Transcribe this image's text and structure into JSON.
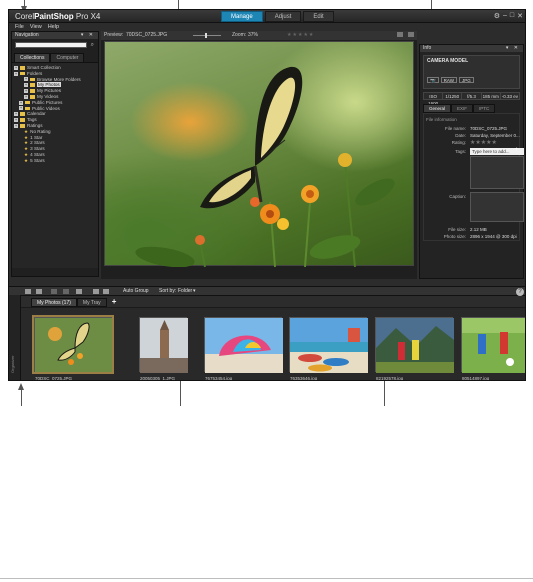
{
  "app": {
    "title_pre": "Corel",
    "title_strong": "PaintShop",
    "title_post": "Pro X4",
    "mode_tabs": [
      "Manage",
      "Adjust",
      "Edit"
    ],
    "active_mode": "Manage",
    "window_controls": [
      "⚙",
      "–",
      "□",
      "✕"
    ]
  },
  "menu": {
    "items": [
      "File",
      "View",
      "Help"
    ]
  },
  "navigation": {
    "header": "Navigation",
    "tabs": [
      "Collections",
      "Computer"
    ],
    "tree": [
      {
        "label": "Smart Collection",
        "icon": "folder"
      },
      {
        "label": "Folders",
        "icon": "folder"
      },
      {
        "label": "Browse More Folders",
        "icon": "folder",
        "indent": 2
      },
      {
        "label": "My Photos",
        "icon": "folder",
        "indent": 2,
        "selected": true
      },
      {
        "label": "My Pictures",
        "icon": "folder",
        "indent": 2
      },
      {
        "label": "My Videos",
        "icon": "folder",
        "indent": 2
      },
      {
        "label": "Public Pictures",
        "icon": "folder",
        "indent": 1
      },
      {
        "label": "Public Videos",
        "icon": "folder",
        "indent": 1
      },
      {
        "label": "Calendar",
        "icon": "folder"
      },
      {
        "label": "Tags",
        "icon": "folder"
      },
      {
        "label": "Ratings",
        "icon": "folder"
      },
      {
        "label": "No Rating",
        "icon": "star",
        "indent": 2
      },
      {
        "label": "1 Star",
        "icon": "star",
        "indent": 2
      },
      {
        "label": "2 Stars",
        "icon": "star",
        "indent": 2
      },
      {
        "label": "3 Stars",
        "icon": "star",
        "indent": 2
      },
      {
        "label": "4 Stars",
        "icon": "star",
        "indent": 2
      },
      {
        "label": "5 Stars",
        "icon": "star",
        "indent": 2
      }
    ]
  },
  "preview": {
    "label": "Preview:",
    "filename": "70DSC_0725.JPG",
    "zoom_label": "Zoom:",
    "zoom_value": "37%",
    "stars": "★★★★★"
  },
  "info": {
    "header": "Info",
    "camera_model": "CAMERA MODEL",
    "file_badges": [
      "RAW",
      "JPG"
    ],
    "exif": [
      "ISO 1600",
      "1/1250",
      "f/5.3",
      "185 mm",
      "-0.33 ev"
    ],
    "tabs": [
      "General",
      "EXIF",
      "IPTC"
    ],
    "section": "File information",
    "file_name_label": "File name:",
    "file_name": "70DSC_0725.JPG",
    "date_label": "Date:",
    "date": "Saturday, September 0...",
    "rating_label": "Rating:",
    "rating_stars": "★★★★★",
    "tags_label": "Tags:",
    "tags_placeholder": "Type here to add...",
    "caption_label": "Caption:",
    "file_size_label": "File size:",
    "file_size": "2.12 MB",
    "photo_size_label": "Photo size:",
    "photo_size": "2896 x 1944 @ 300 dpi"
  },
  "organizer": {
    "auto_group": "Auto Group",
    "sort_by": "Sort by:",
    "sort_value": "Folder",
    "tabs": [
      "My Photos (17)",
      "My Tray"
    ],
    "add_tab": "+",
    "side_label": "Organizer",
    "help": "?",
    "thumbnails": [
      {
        "name": "70DSC_0725.JPG",
        "selected": true
      },
      {
        "name": "20050305_1.JPG"
      },
      {
        "name": "76753454.jpg"
      },
      {
        "name": "76353646.jpg"
      },
      {
        "name": "82192578.jpg"
      },
      {
        "name": "80514897.jpg"
      }
    ]
  }
}
